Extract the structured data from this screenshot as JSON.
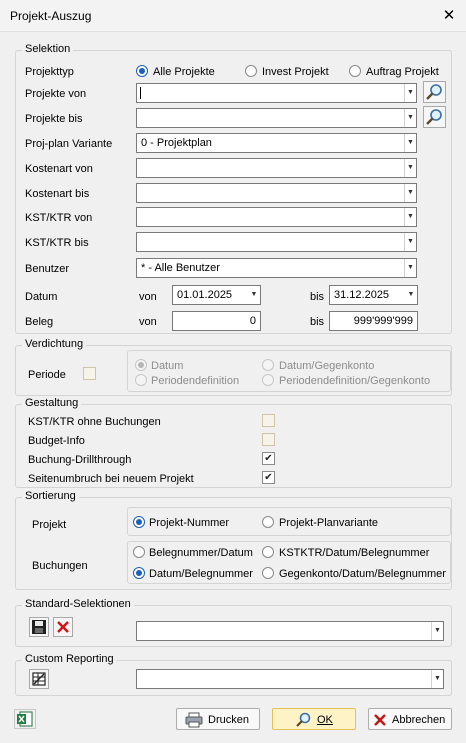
{
  "window": {
    "title": "Projekt-Auszug",
    "close_glyph": "✕"
  },
  "selektion": {
    "legend": "Selektion",
    "projekttyp_label": "Projekttyp",
    "projekttyp_options": [
      {
        "label": "Alle Projekte",
        "selected": true
      },
      {
        "label": "Invest Projekt",
        "selected": false
      },
      {
        "label": "Auftrag Projekt",
        "selected": false
      }
    ],
    "projekte_von_label": "Projekte von",
    "projekte_von_value": "",
    "projekte_bis_label": "Projekte bis",
    "projekte_bis_value": "",
    "proj_plan_variante_label": "Proj-plan Variante",
    "proj_plan_variante_value": "0 - Projektplan",
    "kostenart_von_label": "Kostenart von",
    "kostenart_bis_label": "Kostenart bis",
    "kst_ktr_von_label": "KST/KTR von",
    "kst_ktr_bis_label": "KST/KTR bis",
    "benutzer_label": "Benutzer",
    "benutzer_value": "* - Alle Benutzer",
    "datum_label": "Datum",
    "von_label": "von",
    "bis_label": "bis",
    "datum_von": "01.01.2025",
    "datum_bis": "31.12.2025",
    "beleg_label": "Beleg",
    "beleg_von": "0",
    "beleg_bis": "999'999'999"
  },
  "verdichtung": {
    "legend": "Verdichtung",
    "periode_label": "Periode",
    "periode_checked": false,
    "options": [
      {
        "label": "Datum",
        "selected": true
      },
      {
        "label": "Datum/Gegenkonto",
        "selected": false
      },
      {
        "label": "Periodendefinition",
        "selected": false
      },
      {
        "label": "Periodendefinition/Gegenkonto",
        "selected": false
      }
    ]
  },
  "gestaltung": {
    "legend": "Gestaltung",
    "items": [
      {
        "label": "KST/KTR ohne Buchungen",
        "checked": false,
        "enabled": false
      },
      {
        "label": "Budget-Info",
        "checked": false,
        "enabled": false
      },
      {
        "label": "Buchung-Drillthrough",
        "checked": true,
        "enabled": true
      },
      {
        "label": "Seitenumbruch bei neuem Projekt",
        "checked": true,
        "enabled": true
      }
    ]
  },
  "sortierung": {
    "legend": "Sortierung",
    "projekt_label": "Projekt",
    "projekt_options": [
      {
        "label": "Projekt-Nummer",
        "selected": true
      },
      {
        "label": "Projekt-Planvariante",
        "selected": false
      }
    ],
    "buchungen_label": "Buchungen",
    "buchungen_options": [
      {
        "label": "Belegnummer/Datum",
        "selected": false
      },
      {
        "label": "KSTKTR/Datum/Belegnummer",
        "selected": false
      },
      {
        "label": "Datum/Belegnummer",
        "selected": true
      },
      {
        "label": "Gegenkonto/Datum/Belegnummer",
        "selected": false
      }
    ]
  },
  "standard_selektionen": {
    "legend": "Standard-Selektionen",
    "value": ""
  },
  "custom_reporting": {
    "legend": "Custom Reporting",
    "value": ""
  },
  "footer": {
    "drucken_label": "Drucken",
    "ok_label": "OK",
    "abbrechen_label": "Abbrechen"
  }
}
